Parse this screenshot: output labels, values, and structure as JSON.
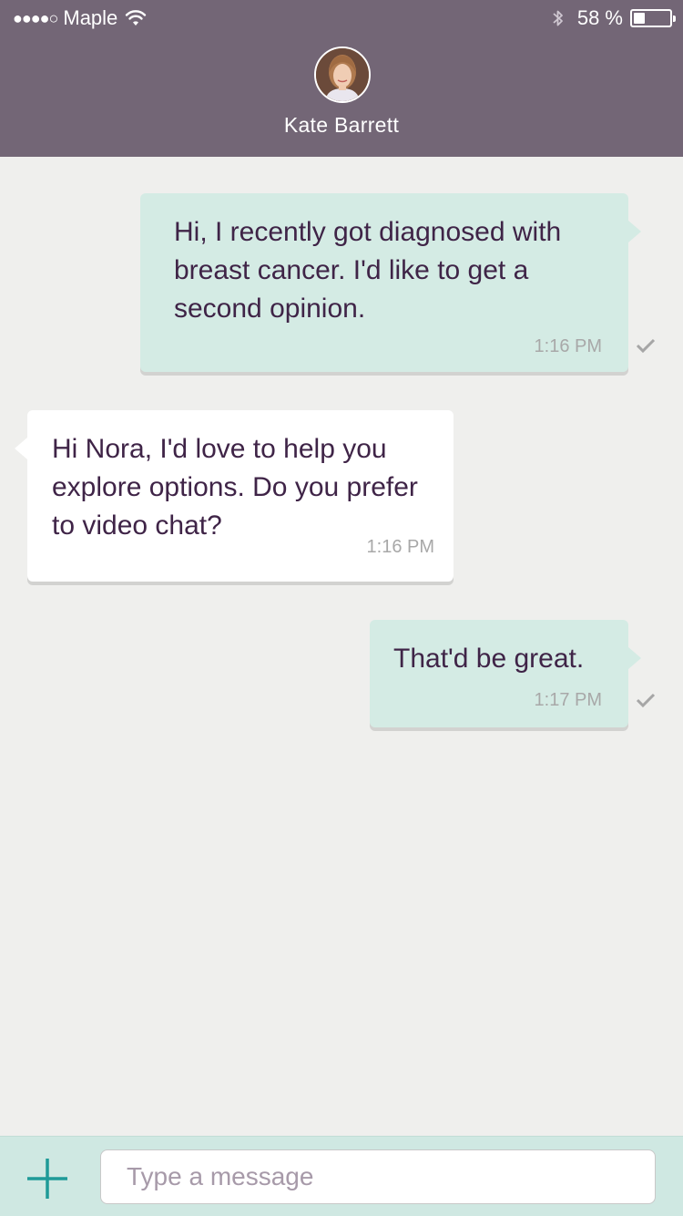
{
  "status_bar": {
    "signal": "●●●●○",
    "carrier": "Maple",
    "battery_percent": "58 %",
    "battery_level": 0.58
  },
  "header": {
    "contact_name": "Kate Barrett"
  },
  "messages": [
    {
      "direction": "outgoing",
      "text": "Hi, I recently got diagnosed with breast cancer. I'd like to get a second opinion.",
      "time": "1:16 PM",
      "delivered": true
    },
    {
      "direction": "incoming",
      "text": "Hi Nora, I'd love to help you explore options. Do you prefer to video chat?",
      "time": "1:16 PM"
    },
    {
      "direction": "outgoing",
      "text": "That'd be great.",
      "time": "1:17 PM",
      "delivered": true
    }
  ],
  "composer": {
    "placeholder": "Type a message",
    "add_icon": "plus-icon"
  },
  "colors": {
    "header_bg": "#736676",
    "outgoing_bubble": "#d4ebe4",
    "incoming_bubble": "#ffffff",
    "message_text": "#3f2447",
    "accent": "#1f9a98"
  }
}
